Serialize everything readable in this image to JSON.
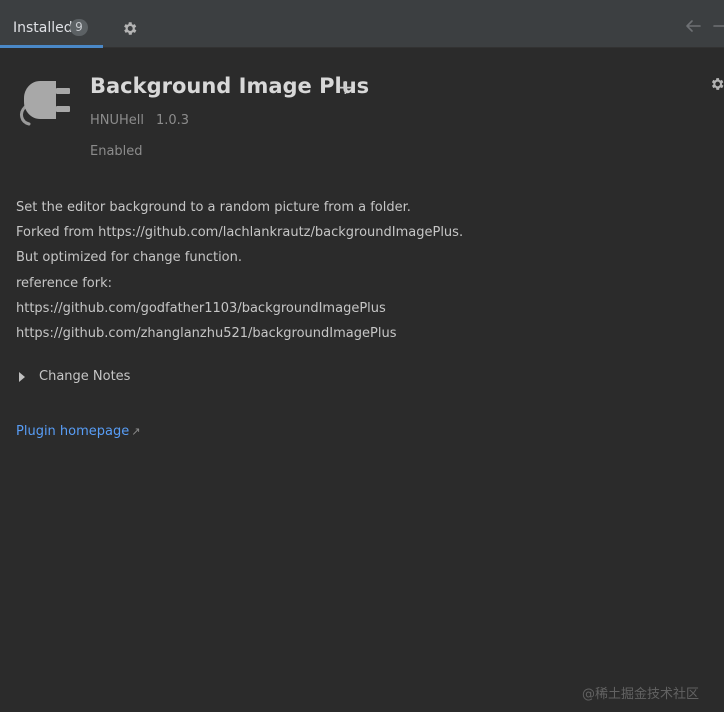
{
  "tabs": {
    "installed_label": "Installed",
    "installed_count": "9"
  },
  "plugin": {
    "name": "Background Image Plus",
    "vendor": "HNUHell",
    "version": "1.0.3",
    "status": "Enabled"
  },
  "description": {
    "lines": [
      "Set the editor background to a random picture from a folder.",
      "Forked from https://github.com/lachlankrautz/backgroundImagePlus.",
      "But optimized for change function.",
      "reference fork:",
      "https://github.com/godfather1103/backgroundImagePlus",
      "https://github.com/zhanglanzhu521/backgroundImagePlus"
    ]
  },
  "change_notes_label": "Change Notes",
  "homepage_label": "Plugin homepage",
  "watermark": "@稀土掘金技术社区",
  "icons": {
    "tab_settings": "gear-icon",
    "back": "arrow-left-icon",
    "forward": "arrow-right-icon",
    "plugin": "plug-icon",
    "plugin_settings": "gear-icon",
    "expand": "triangle-right-icon",
    "external": "external-link-icon"
  },
  "colors": {
    "background": "#2b2b2b",
    "tab_accent": "#4a88c7",
    "link": "#589df6"
  }
}
